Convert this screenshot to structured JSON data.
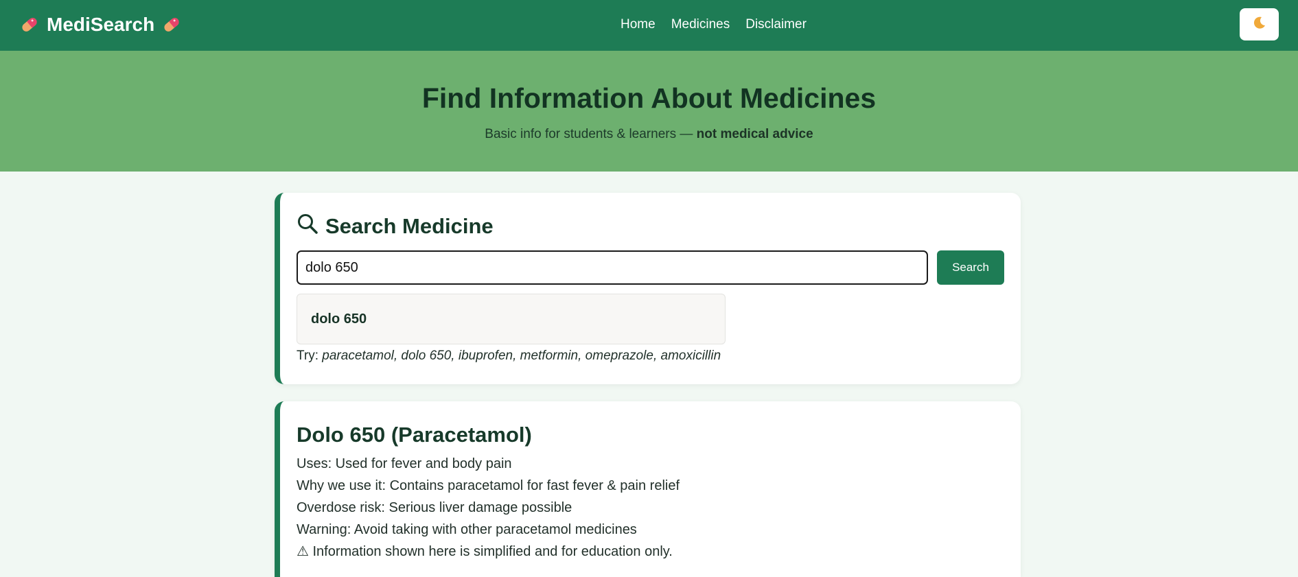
{
  "navbar": {
    "brand": "MediSearch",
    "links": [
      "Home",
      "Medicines",
      "Disclaimer"
    ],
    "theme_toggle_icon": "moon-icon",
    "colors": {
      "background": "#1e7c55"
    }
  },
  "hero": {
    "title": "Find Information About Medicines",
    "subtitle_prefix": "Basic info for students & learners —",
    "subtitle_emphasis": "not medical advice",
    "colors": {
      "background": "#6db06f"
    }
  },
  "search": {
    "title": "Search Medicine",
    "input_value": "dolo 650",
    "button_label": "Search",
    "suggestion": "dolo 650",
    "try_prefix": "Try:",
    "try_examples": "paracetamol, dolo 650, ibuprofen, metformin, omeprazole, amoxicillin"
  },
  "result": {
    "title": "Dolo 650 (Paracetamol)",
    "uses": "Uses: Used for fever and body pain",
    "why": "Why we use it: Contains paracetamol for fast fever & pain relief",
    "overdose": "Overdose risk: Serious liver damage possible",
    "warning": "Warning: Avoid taking with other paracetamol medicines",
    "note": "⚠ Information shown here is simplified and for education only."
  },
  "colors": {
    "accent": "#1e7c55",
    "page_background": "#f1f8f3"
  }
}
